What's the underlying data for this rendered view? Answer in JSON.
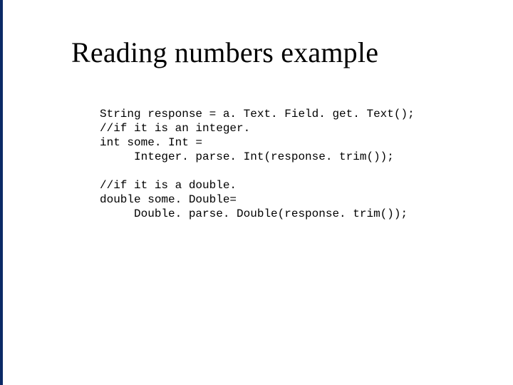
{
  "slide": {
    "title": "Reading numbers example",
    "code": {
      "l1": "String response = a. Text. Field. get. Text();",
      "l2": "//if it is an integer.",
      "l3": "int some. Int =",
      "l4": "     Integer. parse. Int(response. trim());",
      "lblank": "",
      "l5": "//if it is a double.",
      "l6": "double some. Double=",
      "l7": "     Double. parse. Double(response. trim());"
    }
  }
}
